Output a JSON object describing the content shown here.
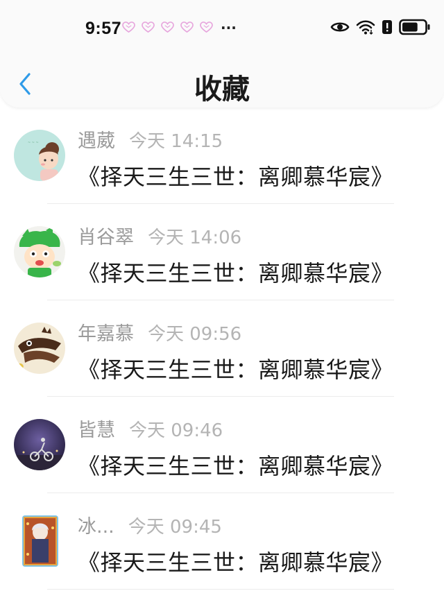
{
  "status_bar": {
    "time": "9:57",
    "more": "···",
    "battery_level": 0.7
  },
  "header": {
    "title": "收藏"
  },
  "items": [
    {
      "name": "遇葳",
      "time": "今天 14:15",
      "book": "《择天三生三世：离卿慕华宸》",
      "avatar": "girl-cartoon-avatar"
    },
    {
      "name": "肖谷翠",
      "time": "今天 14:06",
      "book": "《择天三生三世：离卿慕华宸》",
      "avatar": "green-cartoon-avatar"
    },
    {
      "name": "年嘉慕",
      "time": "今天 09:56",
      "book": "《择天三生三世：离卿慕华宸》",
      "avatar": "chocolate-bird-avatar"
    },
    {
      "name": "皆慧",
      "time": "今天 09:46",
      "book": "《择天三生三世：离卿慕华宸》",
      "avatar": "night-rider-avatar"
    },
    {
      "name": "冰...",
      "time": "今天 09:45",
      "book": "《择天三生三世：离卿慕华宸》",
      "avatar": "anime-character-avatar"
    }
  ],
  "colors": {
    "accent": "#2f9be8",
    "name_gray": "#9a9a9a",
    "time_gray": "#b4b4b4",
    "heart_pink": "#e7a6dd"
  }
}
